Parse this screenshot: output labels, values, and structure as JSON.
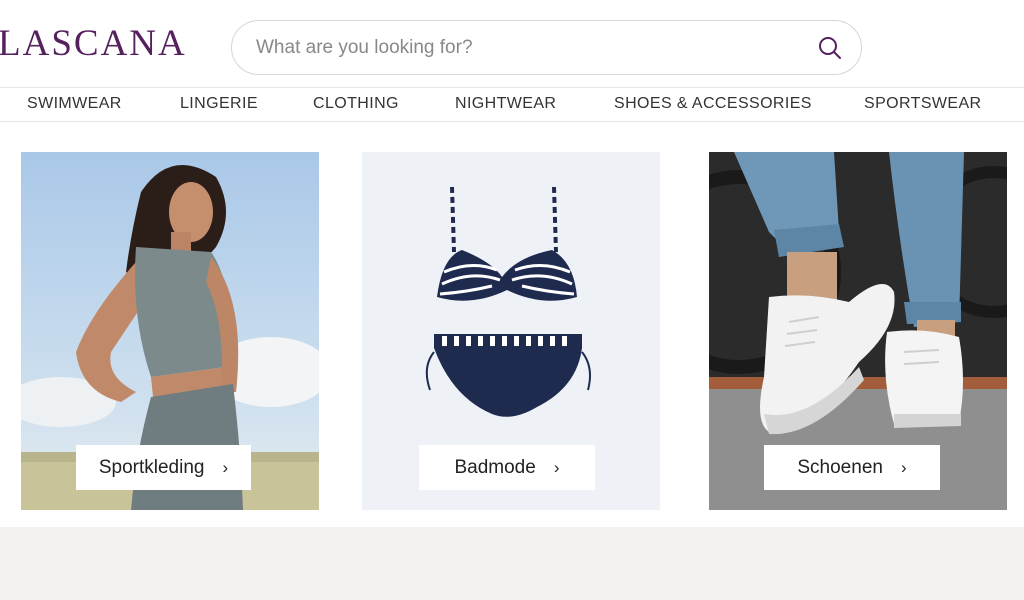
{
  "brand": {
    "logo_text": "LASCANA",
    "logo_color": "#55215e"
  },
  "search": {
    "placeholder": "What are you looking for?",
    "icon": "search-icon"
  },
  "nav": {
    "items": [
      {
        "label": "SWIMWEAR"
      },
      {
        "label": "LINGERIE"
      },
      {
        "label": "CLOTHING"
      },
      {
        "label": "NIGHTWEAR"
      },
      {
        "label": "SHOES & ACCESSORIES"
      },
      {
        "label": "SPORTSWEAR"
      }
    ]
  },
  "tiles": [
    {
      "label": "Sportkleding",
      "chevron": "›",
      "image": "woman-in-sportswear-photo"
    },
    {
      "label": "Badmode",
      "chevron": "›",
      "image": "striped-bikini-photo"
    },
    {
      "label": "Schoenen",
      "chevron": "›",
      "image": "white-sneakers-photo"
    }
  ],
  "colors": {
    "accent": "#55215e",
    "tile_bg": "#eef2f7",
    "band": "#f3f2f1"
  }
}
